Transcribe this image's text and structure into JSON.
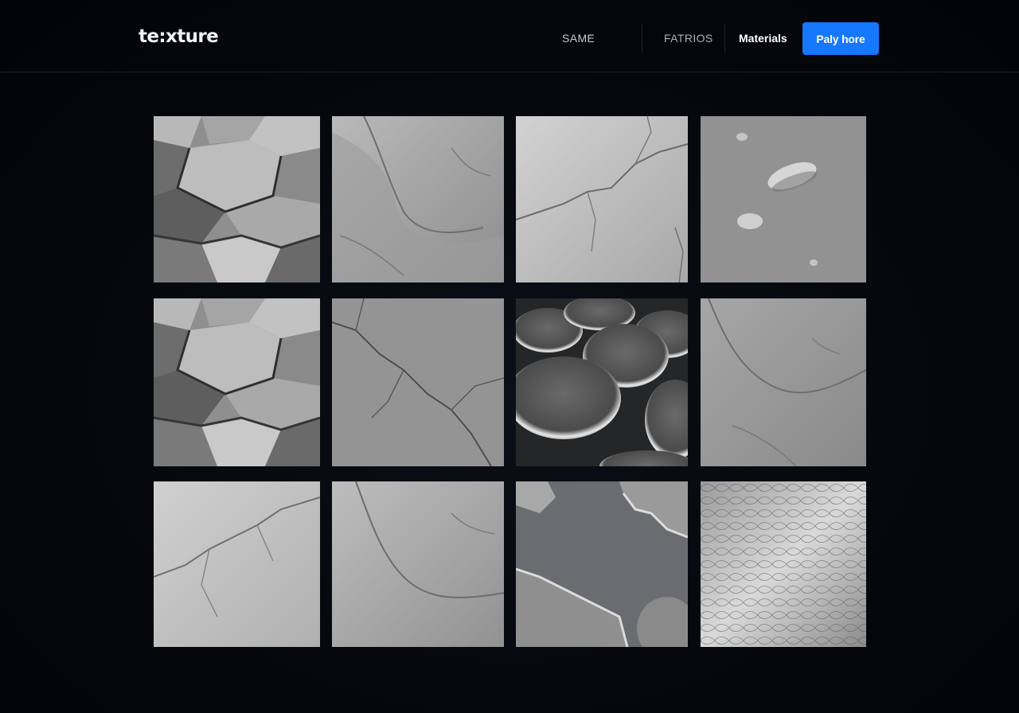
{
  "brand": {
    "logo_text": "te:xture"
  },
  "nav": {
    "items": [
      {
        "label": "SAME"
      },
      {
        "label": "FATRIOS"
      },
      {
        "label": "Materials"
      }
    ],
    "cta_label": "Paly hore"
  },
  "colors": {
    "background": "#04060b",
    "accent": "#1677ff",
    "text_primary": "#ffffff",
    "text_muted": "#c7ccd4"
  },
  "gallery": {
    "rows": 3,
    "columns": 4,
    "tiles": [
      {
        "texture": "faceted-stone"
      },
      {
        "texture": "plaster"
      },
      {
        "texture": "cracked-plaster"
      },
      {
        "texture": "pebble-sand"
      },
      {
        "texture": "faceted-stone"
      },
      {
        "texture": "cracked-concrete"
      },
      {
        "texture": "metal-discs"
      },
      {
        "texture": "plaster"
      },
      {
        "texture": "cracked-plaster"
      },
      {
        "texture": "plaster"
      },
      {
        "texture": "peeling-paint"
      },
      {
        "texture": "hammered-metal"
      }
    ]
  }
}
